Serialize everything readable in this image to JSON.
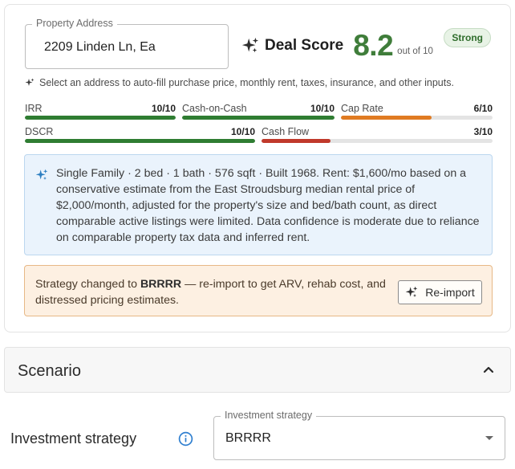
{
  "address": {
    "label": "Property Address",
    "value": "2209 Linden Ln, Ea"
  },
  "deal_score": {
    "label": "Deal Score",
    "value": "8.2",
    "out_of": "out of 10",
    "rating": "Strong",
    "score_color": "#3f7d3a"
  },
  "hint": "Select an address to auto-fill purchase price, monthly rent, taxes, insurance, and other inputs.",
  "metrics": [
    {
      "label": "IRR",
      "score": "10/10",
      "fill": 1.0,
      "color": "#2f7d32"
    },
    {
      "label": "Cash-on-Cash",
      "score": "10/10",
      "fill": 1.0,
      "color": "#2f7d32"
    },
    {
      "label": "Cap Rate",
      "score": "6/10",
      "fill": 0.6,
      "color": "#e07b22"
    },
    {
      "label": "DSCR",
      "score": "10/10",
      "fill": 1.0,
      "color": "#2f7d32"
    },
    {
      "label": "Cash Flow",
      "score": "3/10",
      "fill": 0.3,
      "color": "#c0392b"
    }
  ],
  "summary": "Single Family · 2 bed · 1 bath · 576 sqft · Built 1968. Rent: $1,600/mo based on a conservative estimate from the East Stroudsburg median rental price of $2,000/month, adjusted for the property's size and bed/bath count, as direct comparable active listings were limited. Data confidence is moderate due to reliance on comparable property tax data and inferred rent.",
  "warning": {
    "prefix": "Strategy changed to ",
    "strategy": "BRRRR",
    "suffix": " — re-import to get ARV, rehab cost, and distressed pricing estimates.",
    "button_label": "Re-import"
  },
  "scenario": {
    "title": "Scenario"
  },
  "investment_strategy": {
    "row_label": "Investment strategy",
    "field_label": "Investment strategy",
    "value": "BRRRR"
  },
  "icons": {
    "sparkle": "sparkle-icon",
    "info": "info-icon",
    "chevron": "chevron-up-icon",
    "caret": "caret-down-icon"
  }
}
